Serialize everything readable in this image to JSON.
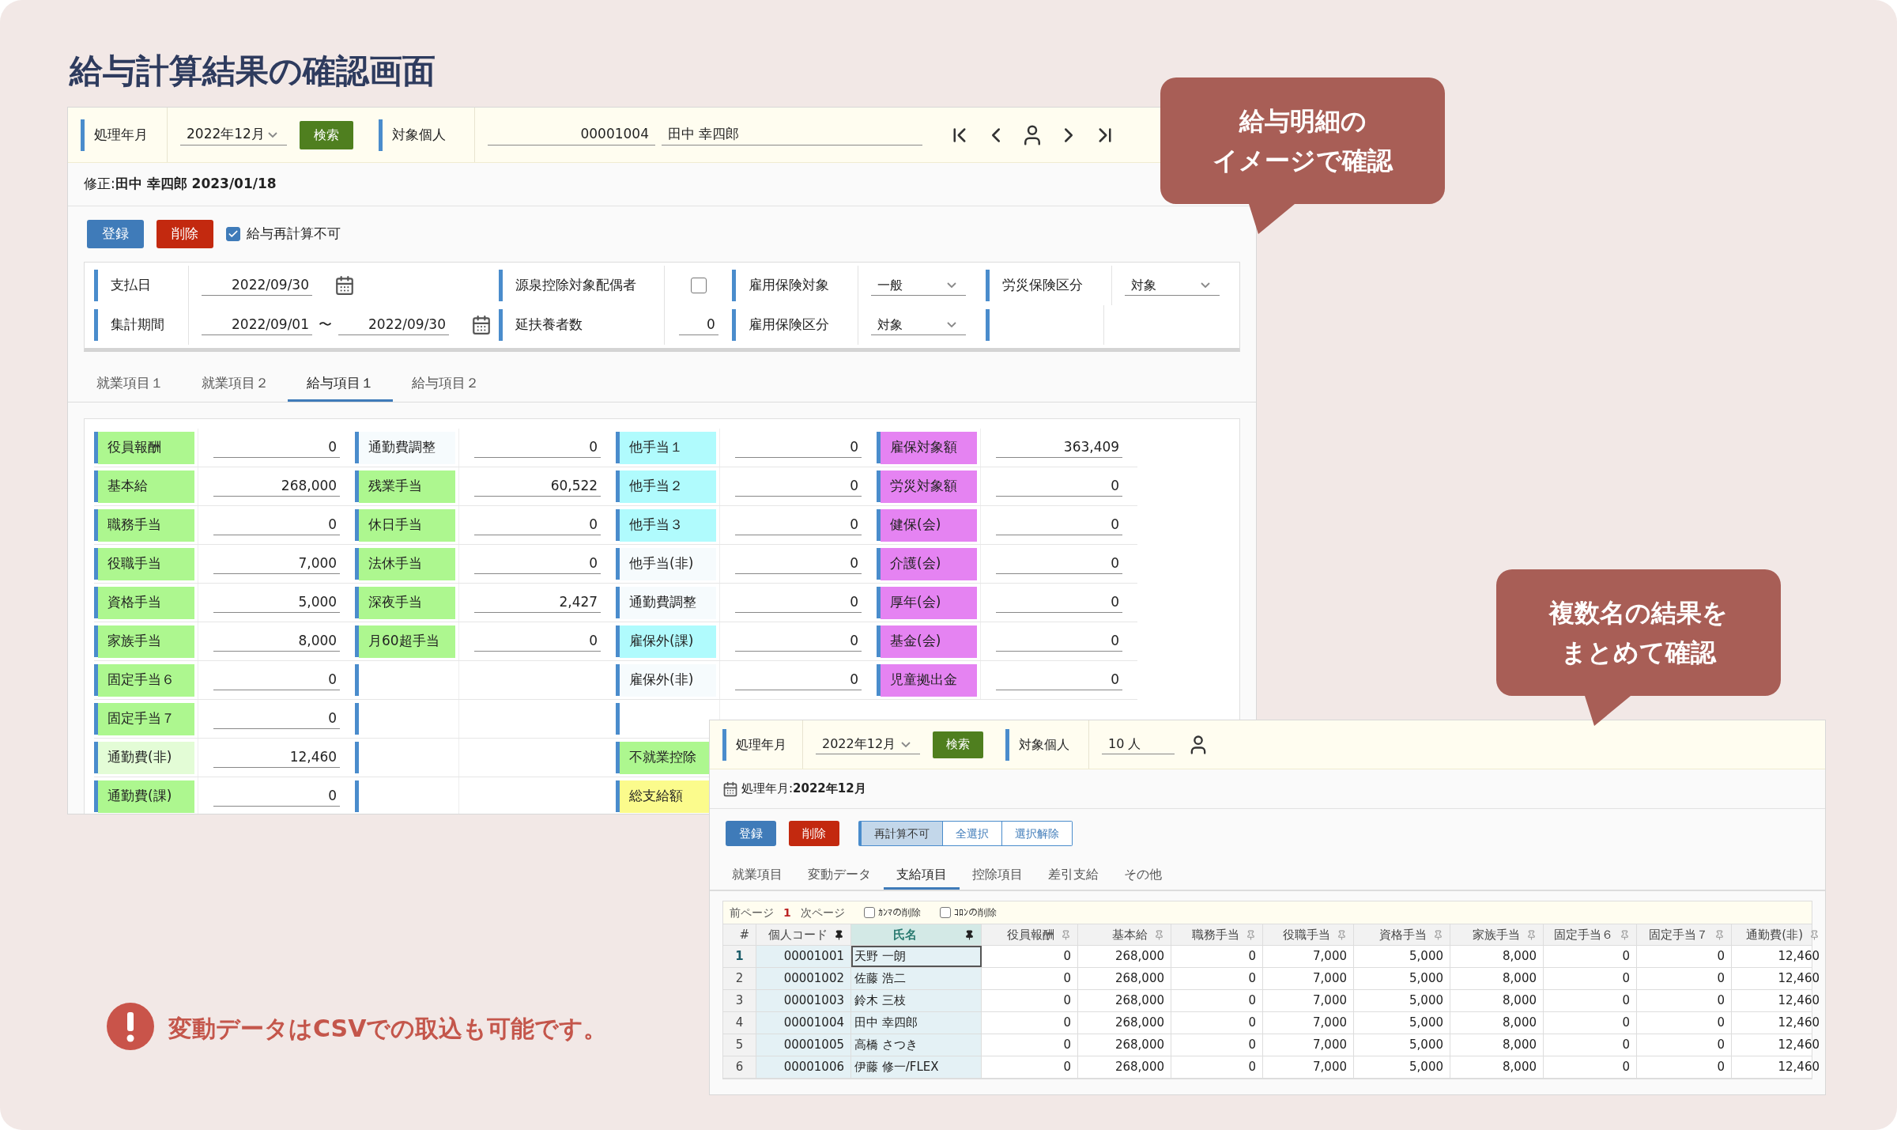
{
  "page_title": "給与計算結果の確認画面",
  "detail_window": {
    "header": {
      "month_label": "処理年月",
      "month": "2022年12月",
      "search": "検索",
      "person_label": "対象個人",
      "code": "00001004",
      "name": "田中 幸四郎"
    },
    "modified": "修正:**田中 幸四郎 2023/01/18**",
    "buttons": [
      {
        "label": "登録",
        "kind": "primary"
      },
      {
        "label": "削除",
        "kind": "danger"
      }
    ],
    "recalc_lock": {
      "label": "給与再計算不可",
      "checked": true
    },
    "form_rows": [
      [
        {
          "kind": "date",
          "label": "支払日",
          "value": "2022/09/30"
        },
        {
          "kind": "checkbox",
          "label": "源泉控除対象配偶者",
          "checked": false
        },
        {
          "kind": "select",
          "label": "雇用保険対象",
          "value": "一般"
        },
        {
          "kind": "select",
          "label": "労災保険区分",
          "value": "対象"
        }
      ],
      [
        {
          "kind": "period",
          "label": "集計期間",
          "from": "2022/09/01",
          "separator": "〜",
          "to": "2022/09/30"
        },
        {
          "kind": "number",
          "label": "延扶養者数",
          "value": "0"
        },
        {
          "kind": "select",
          "label": "雇用保険区分",
          "value": "対象"
        },
        {
          "kind": "empty"
        }
      ]
    ],
    "tabs": [
      {
        "label": "就業項目１",
        "selected": false
      },
      {
        "label": "就業項目２",
        "selected": false
      },
      {
        "label": "給与項目１",
        "selected": true
      },
      {
        "label": "給与項目２",
        "selected": false
      }
    ],
    "grid": [
      [
        {
          "kind": "item",
          "label": "役員報酬",
          "value": "0",
          "color": "#adf78f"
        },
        {
          "kind": "item",
          "label": "基本給",
          "value": "268,000",
          "color": "#adf78f"
        },
        {
          "kind": "item",
          "label": "職務手当",
          "value": "0",
          "color": "#adf78f"
        },
        {
          "kind": "item",
          "label": "役職手当",
          "value": "7,000",
          "color": "#adf78f"
        },
        {
          "kind": "item",
          "label": "資格手当",
          "value": "5,000",
          "color": "#adf78f"
        },
        {
          "kind": "item",
          "label": "家族手当",
          "value": "8,000",
          "color": "#adf78f"
        },
        {
          "kind": "item",
          "label": "固定手当６",
          "value": "0",
          "color": "#adf78f"
        },
        {
          "kind": "item",
          "label": "固定手当７",
          "value": "0",
          "color": "#adf78f"
        },
        {
          "kind": "item",
          "label": "通勤費(非)",
          "value": "12,460",
          "color": "#e3fcd6"
        },
        {
          "kind": "item",
          "label": "通勤費(課)",
          "value": "0",
          "color": "#adf78f"
        }
      ],
      [
        {
          "kind": "item",
          "label": "通勤費調整",
          "value": "0",
          "color": "#f6fbfd"
        },
        {
          "kind": "item",
          "label": "残業手当",
          "value": "60,522",
          "color": "#adf78f"
        },
        {
          "kind": "item",
          "label": "休日手当",
          "value": "0",
          "color": "#adf78f"
        },
        {
          "kind": "item",
          "label": "法休手当",
          "value": "0",
          "color": "#adf78f"
        },
        {
          "kind": "item",
          "label": "深夜手当",
          "value": "2,427",
          "color": "#adf78f"
        },
        {
          "kind": "item",
          "label": "月60超手当",
          "value": "0",
          "color": "#adf78f"
        },
        {
          "kind": "blank"
        },
        {
          "kind": "blank"
        },
        {
          "kind": "blank"
        },
        {
          "kind": "blank"
        }
      ],
      [
        {
          "kind": "item",
          "label": "他手当１",
          "value": "0",
          "color": "#b0fbfd"
        },
        {
          "kind": "item",
          "label": "他手当２",
          "value": "0",
          "color": "#b0fbfd"
        },
        {
          "kind": "item",
          "label": "他手当３",
          "value": "0",
          "color": "#b0fbfd"
        },
        {
          "kind": "item",
          "label": "他手当(非)",
          "value": "0",
          "color": "#f6fbfd"
        },
        {
          "kind": "item",
          "label": "通勤費調整",
          "value": "0",
          "color": "#f6fbfd"
        },
        {
          "kind": "item",
          "label": "雇保外(課)",
          "value": "0",
          "color": "#b0fbfd"
        },
        {
          "kind": "item",
          "label": "雇保外(非)",
          "value": "0",
          "color": "#f6fbfd"
        },
        {
          "kind": "blank"
        },
        {
          "kind": "item",
          "label": "不就業控除",
          "color": "#adf78f"
        },
        {
          "kind": "item",
          "label": "総支給額",
          "color": "#fbfb8c"
        }
      ],
      [
        {
          "kind": "item",
          "label": "雇保対象額",
          "value": "363,409",
          "color": "#e583f2"
        },
        {
          "kind": "item",
          "label": "労災対象額",
          "value": "0",
          "color": "#e583f2"
        },
        {
          "kind": "item",
          "label": "健保(会)",
          "value": "0",
          "color": "#e583f2"
        },
        {
          "kind": "item",
          "label": "介護(会)",
          "value": "0",
          "color": "#e583f2"
        },
        {
          "kind": "item",
          "label": "厚年(会)",
          "value": "0",
          "color": "#e583f2"
        },
        {
          "kind": "item",
          "label": "基金(会)",
          "value": "0",
          "color": "#e583f2"
        },
        {
          "kind": "item",
          "label": "児童拠出金",
          "value": "0",
          "color": "#e583f2"
        }
      ]
    ]
  },
  "list_window": {
    "header": {
      "month_label": "処理年月",
      "month": "2022年12月",
      "search": "検索",
      "person_label": "対象個人",
      "count": "10 人"
    },
    "period": "処理年月:**2022年12月**",
    "buttons": [
      {
        "label": "登録",
        "kind": "primary"
      },
      {
        "label": "削除",
        "kind": "danger"
      }
    ],
    "toggles": [
      {
        "label": "再計算不可",
        "selected": true
      },
      {
        "label": "全選択",
        "selected": false
      },
      {
        "label": "選択解除",
        "selected": false
      }
    ],
    "tabs": [
      {
        "label": "就業項目",
        "selected": false
      },
      {
        "label": "変動データ",
        "selected": false
      },
      {
        "label": "支給項目",
        "selected": true
      },
      {
        "label": "控除項目",
        "selected": false
      },
      {
        "label": "差引支給",
        "selected": false
      },
      {
        "label": "その他",
        "selected": false
      }
    ],
    "pager": {
      "prev": "前ページ",
      "page": "1",
      "next": "次ページ"
    },
    "options": [
      {
        "label": "ｶﾝﾏの削除",
        "checked": false
      },
      {
        "label": "ｺﾛﾝの削除",
        "checked": false
      }
    ],
    "columns": [
      {
        "label": "#"
      },
      {
        "label": "個人コード",
        "pinned": true
      },
      {
        "label": "氏名",
        "pinned": true
      },
      {
        "label": "役員報酬",
        "pinned": false
      },
      {
        "label": "基本給",
        "pinned": false
      },
      {
        "label": "職務手当",
        "pinned": false
      },
      {
        "label": "役職手当",
        "pinned": false
      },
      {
        "label": "資格手当",
        "pinned": false
      },
      {
        "label": "家族手当",
        "pinned": false
      },
      {
        "label": "固定手当６",
        "pinned": false
      },
      {
        "label": "固定手当７",
        "pinned": false
      },
      {
        "label": "通勤費(非)",
        "pinned": false
      }
    ],
    "rows": [
      {
        "selected": true,
        "cells": [
          "1",
          "00001001",
          "天野 一朗",
          "0",
          "268,000",
          "0",
          "7,000",
          "5,000",
          "8,000",
          "0",
          "0",
          "12,460"
        ]
      },
      {
        "selected": false,
        "cells": [
          "2",
          "00001002",
          "佐藤 浩二",
          "0",
          "268,000",
          "0",
          "7,000",
          "5,000",
          "8,000",
          "0",
          "0",
          "12,460"
        ]
      },
      {
        "selected": false,
        "cells": [
          "3",
          "00001003",
          "鈴木 三枝",
          "0",
          "268,000",
          "0",
          "7,000",
          "5,000",
          "8,000",
          "0",
          "0",
          "12,460"
        ]
      },
      {
        "selected": false,
        "cells": [
          "4",
          "00001004",
          "田中 幸四郎",
          "0",
          "268,000",
          "0",
          "7,000",
          "5,000",
          "8,000",
          "0",
          "0",
          "12,460"
        ]
      },
      {
        "selected": false,
        "cells": [
          "5",
          "00001005",
          "高橋 さつき",
          "0",
          "268,000",
          "0",
          "7,000",
          "5,000",
          "8,000",
          "0",
          "0",
          "12,460"
        ]
      },
      {
        "selected": false,
        "cells": [
          "6",
          "00001006",
          "伊藤 修一/FLEX",
          "0",
          "268,000",
          "0",
          "7,000",
          "5,000",
          "8,000",
          "0",
          "0",
          "12,460"
        ]
      }
    ]
  },
  "callouts": [
    {
      "lines": [
        "給与明細の",
        "イメージで確認"
      ]
    },
    {
      "lines": [
        "複数名の結果を",
        "まとめて確認"
      ]
    }
  ],
  "note": "変動データはCSVでの取込も可能です。"
}
